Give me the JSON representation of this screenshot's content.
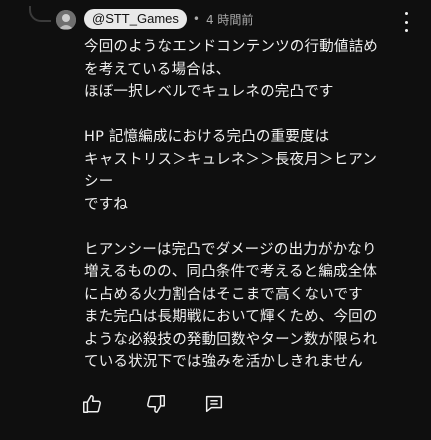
{
  "comment": {
    "author": "@STT_Games",
    "separator": "•",
    "timestamp": "4 時間前",
    "text": "今回のようなエンドコンテンツの行動値詰め\nを考えている場合は、\nほぼ一択レベルでキュレネの完凸です\n\nHP 記憶編成における完凸の重要度は\nキャストリス＞キュレネ＞＞長夜月＞ヒアン\nシー\nですね\n\nヒアンシーは完凸でダメージの出力がかなり\n増えるものの、同凸条件で考えると編成全体\nに占める火力割合はそこまで高くないです\nまた完凸は長期戦において輝くため、今回の\nような必殺技の発動回数やターン数が限られ\nている状況下では強みを活かしきれません"
  },
  "icons": {
    "avatar": "avatar",
    "more": "kebab-menu-icon",
    "like": "thumbs-up-icon",
    "dislike": "thumbs-down-icon",
    "reply": "comment-reply-icon"
  },
  "colors": {
    "background": "#0f0f0f",
    "text": "#f1f1f1",
    "secondary_text": "#aaaaaa",
    "badge_background": "#e8e8e8"
  }
}
